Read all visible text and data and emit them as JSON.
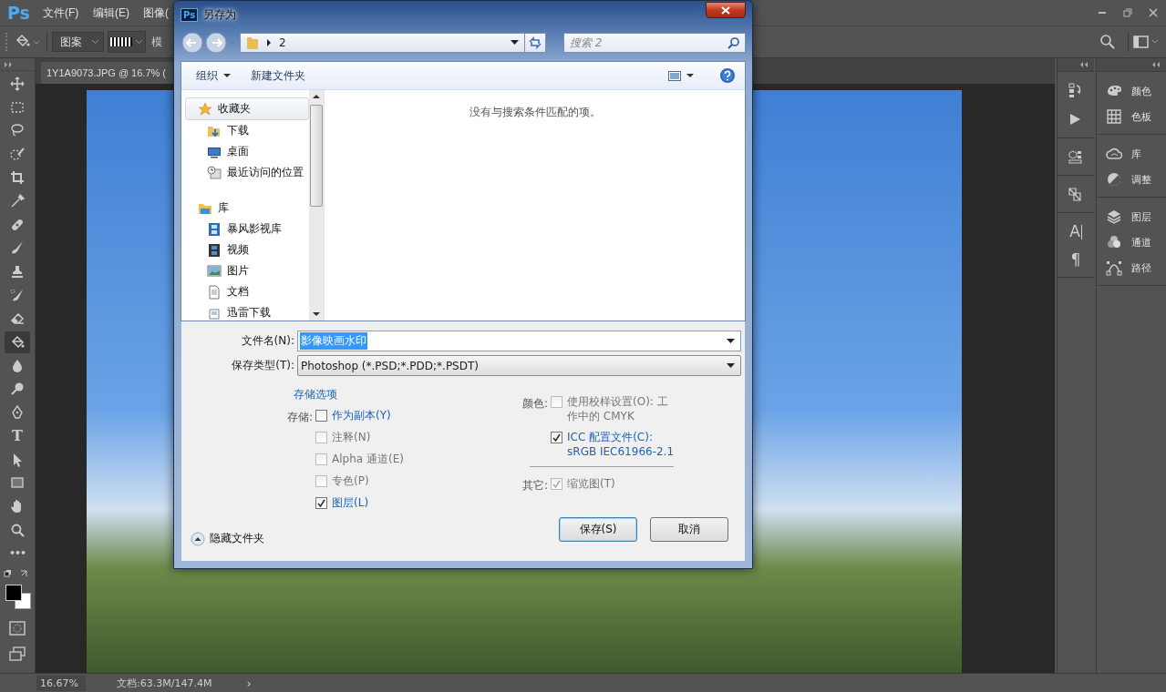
{
  "app": {
    "logo": "Ps",
    "menu": [
      {
        "label": "文件(F)"
      },
      {
        "label": "编辑(E)"
      },
      {
        "label": "图像("
      }
    ]
  },
  "options_bar": {
    "fill_source": "图案",
    "mode_label": "模"
  },
  "document_tab": {
    "title": "1Y1A9073.JPG @ 16.7% ("
  },
  "tools": [
    {
      "selected": false
    },
    {
      "selected": false
    },
    {
      "selected": false
    },
    {
      "selected": false
    },
    {
      "selected": false
    },
    {
      "selected": false
    },
    {
      "selected": false
    },
    {
      "selected": false
    },
    {
      "selected": false
    },
    {
      "selected": false
    },
    {
      "selected": false
    },
    {
      "selected": true
    },
    {
      "selected": false
    },
    {
      "selected": false
    },
    {
      "selected": false
    },
    {
      "selected": false,
      "glyph": "T"
    },
    {
      "selected": false
    },
    {
      "selected": false
    },
    {
      "selected": false
    },
    {
      "selected": false
    },
    {
      "selected": false,
      "glyph": "•••"
    }
  ],
  "narrow_panel_glyphs": [
    "A",
    "¶"
  ],
  "panels": [
    [
      {
        "label": "颜色"
      },
      {
        "label": "色板"
      }
    ],
    [
      {
        "label": "库"
      },
      {
        "label": "调整"
      }
    ],
    [
      {
        "label": "图层"
      },
      {
        "label": "通道"
      },
      {
        "label": "路径"
      }
    ]
  ],
  "status_bar": {
    "zoom": "16.67%",
    "doc_info": "文档:63.3M/147.4M",
    "arrow": "›"
  },
  "dialog": {
    "logo": "Ps",
    "title": "另存为",
    "path": "2",
    "search_placeholder": "搜索 2",
    "toolbar": {
      "organize": "组织",
      "new_folder": "新建文件夹"
    },
    "nav": [
      {
        "label": "收藏夹",
        "selected": true,
        "children": [
          {
            "label": "下载",
            "selected": false
          },
          {
            "label": "桌面",
            "selected": false
          },
          {
            "label": "最近访问的位置",
            "selected": false
          }
        ]
      },
      {
        "label": "库",
        "selected": false,
        "children": [
          {
            "label": "暴风影视库",
            "selected": false
          },
          {
            "label": "视频",
            "selected": false
          },
          {
            "label": "图片",
            "selected": false
          },
          {
            "label": "文档",
            "selected": false
          },
          {
            "label": "迅雷下载",
            "selected": false
          }
        ]
      }
    ],
    "empty_message": "没有与搜索条件匹配的项。",
    "filename": {
      "label": "文件名(N):",
      "value": "影像映画水印",
      "text_selected": true
    },
    "file_type": {
      "label": "保存类型(T):",
      "value": "Photoshop (*.PSD;*.PDD;*.PSDT)"
    },
    "options_title": "存储选项",
    "save_label": "存储:",
    "save_options": [
      {
        "label": "作为副本(Y)",
        "checked": false,
        "disabled": false
      },
      {
        "label": "注释(N)",
        "checked": false,
        "disabled": true
      },
      {
        "label": "Alpha 通道(E)",
        "checked": false,
        "disabled": true
      },
      {
        "label": "专色(P)",
        "checked": false,
        "disabled": true
      },
      {
        "label": "图层(L)",
        "checked": true,
        "disabled": false
      }
    ],
    "color_label": "颜色:",
    "color_options": [
      {
        "label": "使用校样设置(O): 工作中的 CMYK",
        "checked": false,
        "disabled": true
      },
      {
        "label": "ICC 配置文件(C): sRGB IEC61966-2.1",
        "checked": true,
        "disabled": false
      }
    ],
    "other_label": "其它:",
    "other_options": [
      {
        "label": "缩览图(T)",
        "checked": true,
        "disabled": true
      }
    ],
    "hide_folders": "隐藏文件夹",
    "buttons": [
      {
        "label": "保存(S)",
        "default": true
      },
      {
        "label": "取消",
        "default": false
      }
    ]
  }
}
